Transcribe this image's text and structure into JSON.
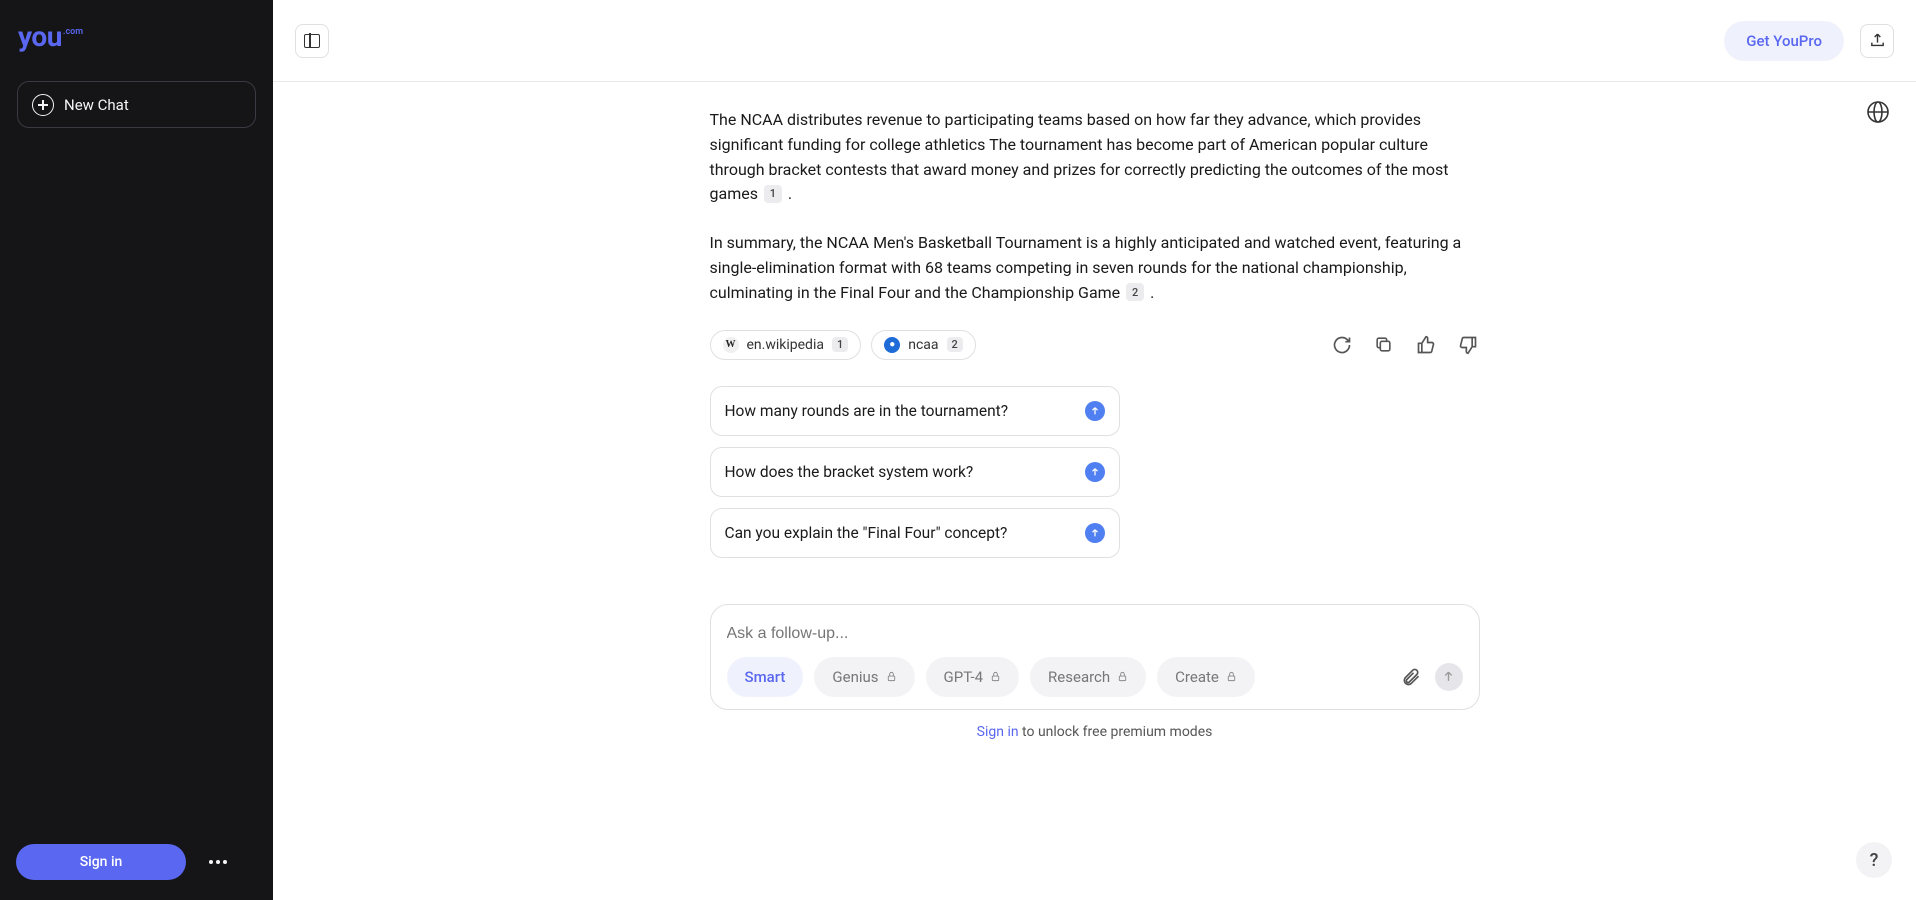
{
  "brand": {
    "name": "you",
    "suffix": ".com"
  },
  "sidebar": {
    "new_chat_label": "New Chat",
    "sign_in_label": "Sign in"
  },
  "topbar": {
    "get_pro_label": "Get YouPro"
  },
  "response": {
    "para1": "The NCAA distributes revenue to participating teams based on how far they advance, which provides significant funding for college athletics The tournament has become part of American popular culture through bracket contests that award money and prizes for correctly predicting the outcomes of the most games",
    "para1_cite": "1",
    "para1_period": ".",
    "para2": "In summary, the NCAA Men's Basketball Tournament is a highly anticipated and watched event, featuring a single-elimination format with 68 teams competing in seven rounds for the national championship, culminating in the Final Four and the Championship Game",
    "para2_cite": "2",
    "para2_period": "."
  },
  "sources": [
    {
      "icon": "W",
      "label": "en.wikipedia",
      "num": "1"
    },
    {
      "icon": "●",
      "label": "ncaa",
      "num": "2"
    }
  ],
  "suggestions": [
    "How many rounds are in the tournament?",
    "How does the bracket system work?",
    "Can you explain the \"Final Four\" concept?"
  ],
  "input": {
    "placeholder": "Ask a follow-up...",
    "modes": [
      {
        "label": "Smart",
        "active": true
      },
      {
        "label": "Genius",
        "locked": true
      },
      {
        "label": "GPT-4",
        "locked": true
      },
      {
        "label": "Research",
        "locked": true
      },
      {
        "label": "Create",
        "locked": true
      }
    ]
  },
  "unlock": {
    "link": "Sign in",
    "rest": " to unlock free premium modes"
  },
  "help": "?"
}
